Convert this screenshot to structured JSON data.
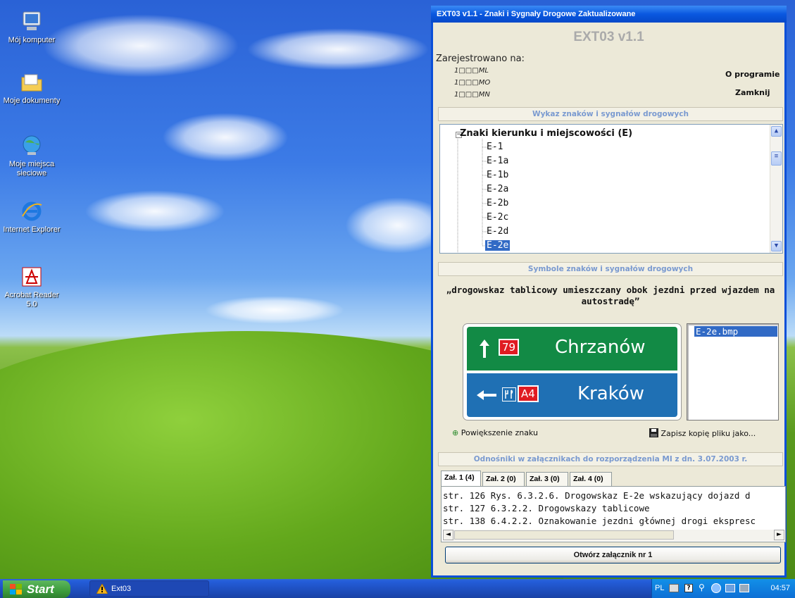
{
  "desktop": {
    "icons": [
      {
        "label": "Mój komputer"
      },
      {
        "label": "Moje dokumenty"
      },
      {
        "label": "Moje miejsca sieciowe"
      },
      {
        "label": "Internet Explorer"
      },
      {
        "label": "Acrobat Reader 5.0"
      }
    ]
  },
  "window": {
    "title": "EXT03 v1.1 - Znaki i Sygnały Drogowe Zaktualizowane",
    "app_title": "EXT03 v1.1",
    "registered_label": "Zarejestrowano na:",
    "registered_lines": [
      "1□□□ML",
      "1□□□MO",
      "1□□□MN"
    ],
    "about_button": "O programie",
    "close_button": "Zamknij",
    "list_section_title": "Wykaz znaków i sygnałów drogowych",
    "tree": {
      "root": "Znaki kierunku i miejscowości (E)",
      "items": [
        "E-1",
        "E-1a",
        "E-1b",
        "E-2a",
        "E-2b",
        "E-2c",
        "E-2d",
        "E-2e"
      ],
      "selected": "E-2e"
    },
    "symbols_section_title": "Symbole znaków i sygnałów drogowych",
    "description": "„drogowskaz tablicowy umieszczany obok jezdni przed wjazdem na autostradę”",
    "sign": {
      "top_route": "79",
      "top_text": "Chrzanów",
      "bottom_route": "A4",
      "bottom_text": "Kraków"
    },
    "file_list": [
      "E-2e.bmp"
    ],
    "zoom_link": "Powiększenie znaku",
    "save_link": "Zapisz kopię pliku jako...",
    "refs_section_title": "Odnośniki w załącznikach do rozporządzenia MI z dn. 3.07.2003 r.",
    "tabs": [
      "Zał. 1 (4)",
      "Zał. 2 (0)",
      "Zał. 3 (0)",
      "Zał. 4 (0)"
    ],
    "refs": [
      "str. 126  Rys. 6.3.2.6. Drogowskaz E-2e wskazujący dojazd d",
      "str. 127  6.3.2.2. Drogowskazy tablicowe",
      "str. 138  6.4.2.2. Oznakowanie jezdni głównej drogi ekspresc"
    ],
    "open_button": "Otwórz załącznik nr 1"
  },
  "taskbar": {
    "start": "Start",
    "task": "Ext03",
    "lang": "PL",
    "clock": "04:57"
  },
  "colors": {
    "sign_green": "#128a45",
    "sign_blue": "#1f70b4",
    "selection": "#316ac5",
    "title_bar": "#0a58e0"
  }
}
